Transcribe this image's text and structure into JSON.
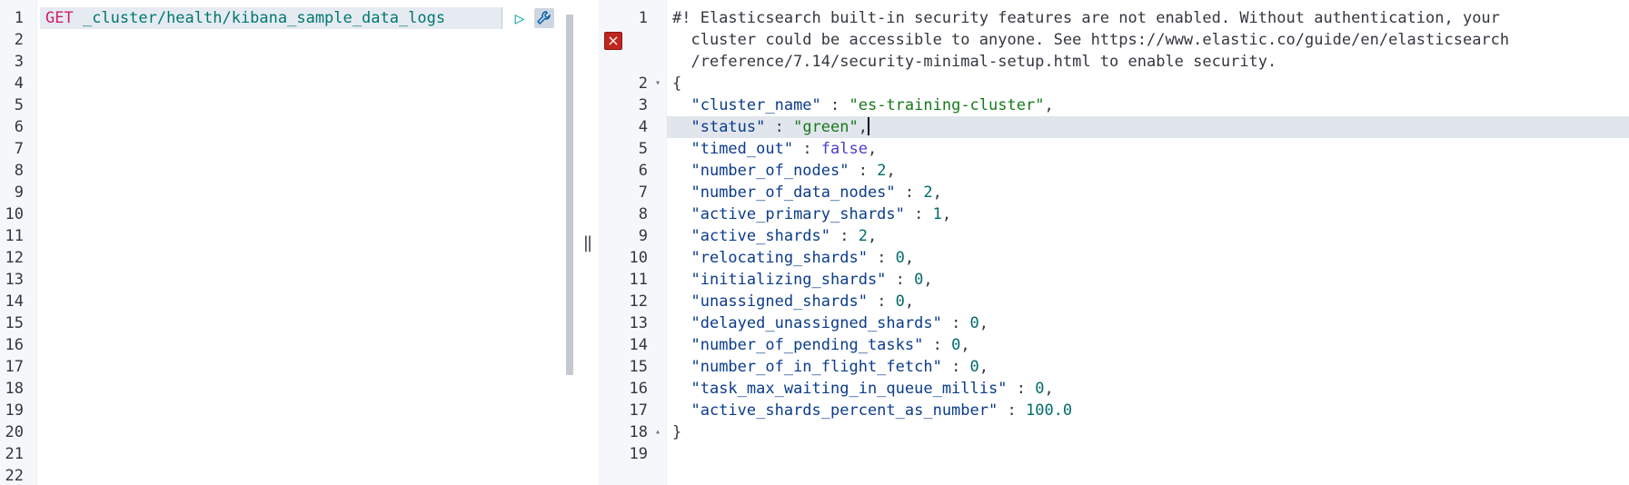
{
  "request_pane": {
    "line_numbers": [
      "1",
      "2",
      "3",
      "4",
      "5",
      "6",
      "7",
      "8",
      "9",
      "10",
      "11",
      "12",
      "13",
      "14",
      "15",
      "16",
      "17",
      "18",
      "19",
      "20",
      "21",
      "22"
    ],
    "method": "GET",
    "url": " _cluster/health/kibana_sample_data_logs",
    "play_icon": "▷",
    "wrench_icon": "wrench-icon"
  },
  "resizer_label": "||",
  "response_pane": {
    "line_numbers": [
      "1",
      "",
      "",
      "2",
      "3",
      "4",
      "5",
      "6",
      "7",
      "8",
      "9",
      "10",
      "11",
      "12",
      "13",
      "14",
      "15",
      "16",
      "17",
      "18",
      "19"
    ],
    "fold_markers": {
      "open": "▾",
      "close": "▴"
    },
    "warning_lines": [
      "#! Elasticsearch built-in security features are not enabled. Without authentication, your",
      "  cluster could be accessible to anyone. See https://www.elastic.co/guide/en/elasticsearch",
      "  /reference/7.14/security-minimal-setup.html to enable security."
    ],
    "open_brace": "{",
    "close_brace": "}",
    "fields": [
      {
        "key": "\"cluster_name\"",
        "value": "\"es-training-cluster\"",
        "type": "str"
      },
      {
        "key": "\"status\"",
        "value": "\"green\"",
        "type": "str"
      },
      {
        "key": "\"timed_out\"",
        "value": "false",
        "type": "kw"
      },
      {
        "key": "\"number_of_nodes\"",
        "value": "2",
        "type": "num"
      },
      {
        "key": "\"number_of_data_nodes\"",
        "value": "2",
        "type": "num"
      },
      {
        "key": "\"active_primary_shards\"",
        "value": "1",
        "type": "num"
      },
      {
        "key": "\"active_shards\"",
        "value": "2",
        "type": "num"
      },
      {
        "key": "\"relocating_shards\"",
        "value": "0",
        "type": "num"
      },
      {
        "key": "\"initializing_shards\"",
        "value": "0",
        "type": "num"
      },
      {
        "key": "\"unassigned_shards\"",
        "value": "0",
        "type": "num"
      },
      {
        "key": "\"delayed_unassigned_shards\"",
        "value": "0",
        "type": "num"
      },
      {
        "key": "\"number_of_pending_tasks\"",
        "value": "0",
        "type": "num"
      },
      {
        "key": "\"number_of_in_flight_fetch\"",
        "value": "0",
        "type": "num"
      },
      {
        "key": "\"task_max_waiting_in_queue_millis\"",
        "value": "0",
        "type": "num"
      },
      {
        "key": "\"active_shards_percent_as_number\"",
        "value": "100.0",
        "type": "num"
      }
    ],
    "error_icon": "close-icon",
    "error_glyph": "×"
  }
}
